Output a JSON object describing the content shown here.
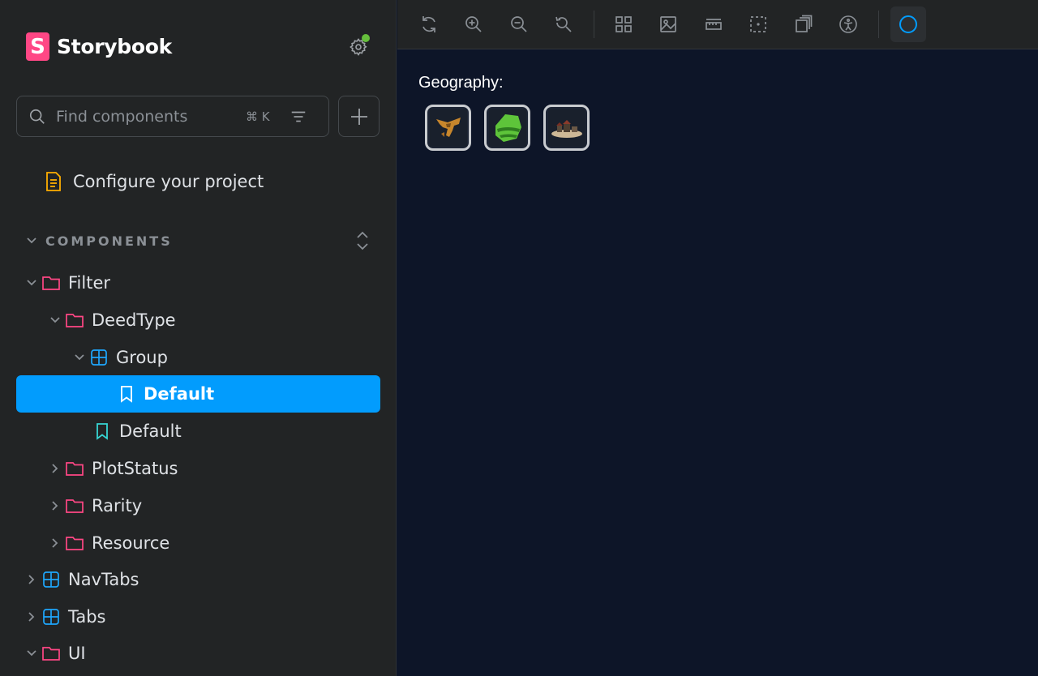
{
  "sidebar": {
    "brand": {
      "logo_letter": "S",
      "name": "Storybook",
      "logo_color": "#ff4785"
    },
    "settings_indicator_color": "#66bf3c",
    "search": {
      "placeholder": "Find components",
      "shortcut": "⌘ K"
    },
    "configure": {
      "label": "Configure your project"
    },
    "section": {
      "label": "COMPONENTS"
    },
    "tree": [
      {
        "label": "Filter",
        "kind": "folder",
        "expanded": true
      },
      {
        "label": "DeedType",
        "kind": "folder",
        "expanded": true
      },
      {
        "label": "Group",
        "kind": "component",
        "expanded": true
      },
      {
        "label": "Default",
        "kind": "story",
        "selected": true
      },
      {
        "label": "Default",
        "kind": "story",
        "selected": false
      },
      {
        "label": "PlotStatus",
        "kind": "folder",
        "expanded": false
      },
      {
        "label": "Rarity",
        "kind": "folder",
        "expanded": false
      },
      {
        "label": "Resource",
        "kind": "folder",
        "expanded": false
      },
      {
        "label": "NavTabs",
        "kind": "component",
        "expanded": false
      },
      {
        "label": "Tabs",
        "kind": "component",
        "expanded": false
      },
      {
        "label": "UI",
        "kind": "folder",
        "expanded": true
      }
    ]
  },
  "toolbar": {
    "buttons": [
      "reload-icon",
      "zoom-in-icon",
      "zoom-out-icon",
      "zoom-reset-icon",
      "grid-icon",
      "background-icon",
      "measure-icon",
      "outline-icon",
      "viewport-icon",
      "accessibility-icon",
      "theme-icon"
    ],
    "accent_color": "#029cfd"
  },
  "canvas": {
    "label": "Geography:",
    "items": [
      "desert-geography",
      "forest-geography",
      "plains-geography"
    ]
  }
}
